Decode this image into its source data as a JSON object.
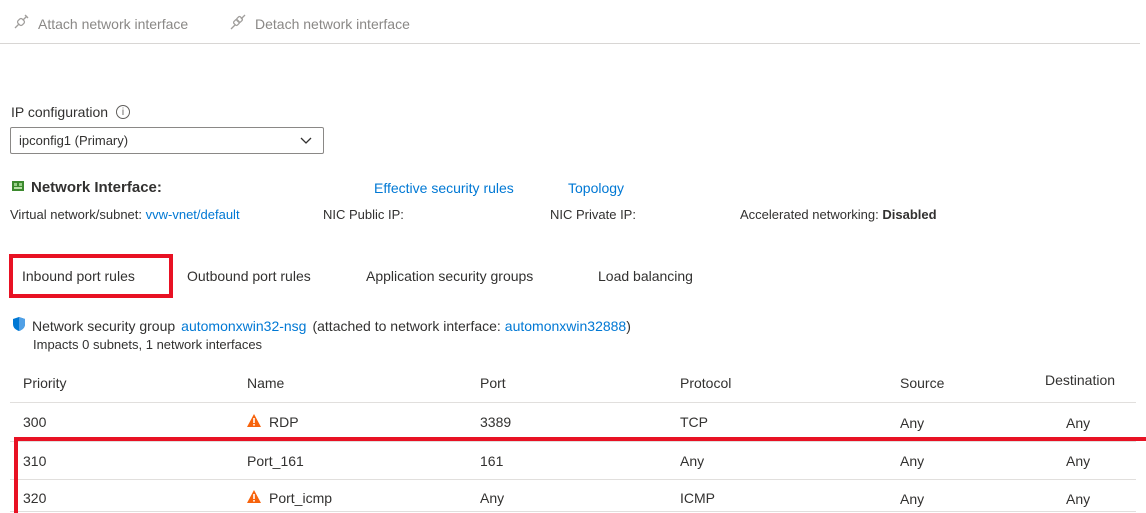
{
  "toolbar": {
    "attach_label": "Attach network interface",
    "detach_label": "Detach network interface"
  },
  "ip_config": {
    "label": "IP configuration",
    "selected": "ipconfig1 (Primary)"
  },
  "nic": {
    "title": "Network Interface:",
    "effective_rules_link": "Effective security rules",
    "topology_link": "Topology",
    "vnet_label": "Virtual network/subnet:",
    "vnet_value": "vvw-vnet/default",
    "public_ip_label": "NIC Public IP:",
    "private_ip_label": "NIC Private IP:",
    "accel_label": "Accelerated networking:",
    "accel_value": "Disabled"
  },
  "tabs": [
    {
      "label": "Inbound port rules",
      "active": true
    },
    {
      "label": "Outbound port rules",
      "active": false
    },
    {
      "label": "Application security groups",
      "active": false
    },
    {
      "label": "Load balancing",
      "active": false
    }
  ],
  "nsg": {
    "prefix": "Network security group",
    "name": "automonxwin32-nsg",
    "middle": "(attached to network interface:",
    "nic_name": "automonxwin32888",
    "suffix": ")",
    "impacts": "Impacts 0 subnets, 1 network interfaces"
  },
  "table": {
    "headers": [
      "Priority",
      "Name",
      "Port",
      "Protocol",
      "Source",
      "Destination"
    ],
    "rows": [
      {
        "priority": "300",
        "name": "RDP",
        "warning": true,
        "port": "3389",
        "protocol": "TCP",
        "source": "Any",
        "destination": "Any"
      },
      {
        "priority": "310",
        "name": "Port_161",
        "warning": false,
        "port": "161",
        "protocol": "Any",
        "source": "Any",
        "destination": "Any"
      },
      {
        "priority": "320",
        "name": "Port_icmp",
        "warning": true,
        "port": "Any",
        "protocol": "ICMP",
        "source": "Any",
        "destination": "Any"
      }
    ]
  },
  "colors": {
    "link": "#0078d4",
    "highlight": "#e81123",
    "warning": "#f7630c"
  }
}
